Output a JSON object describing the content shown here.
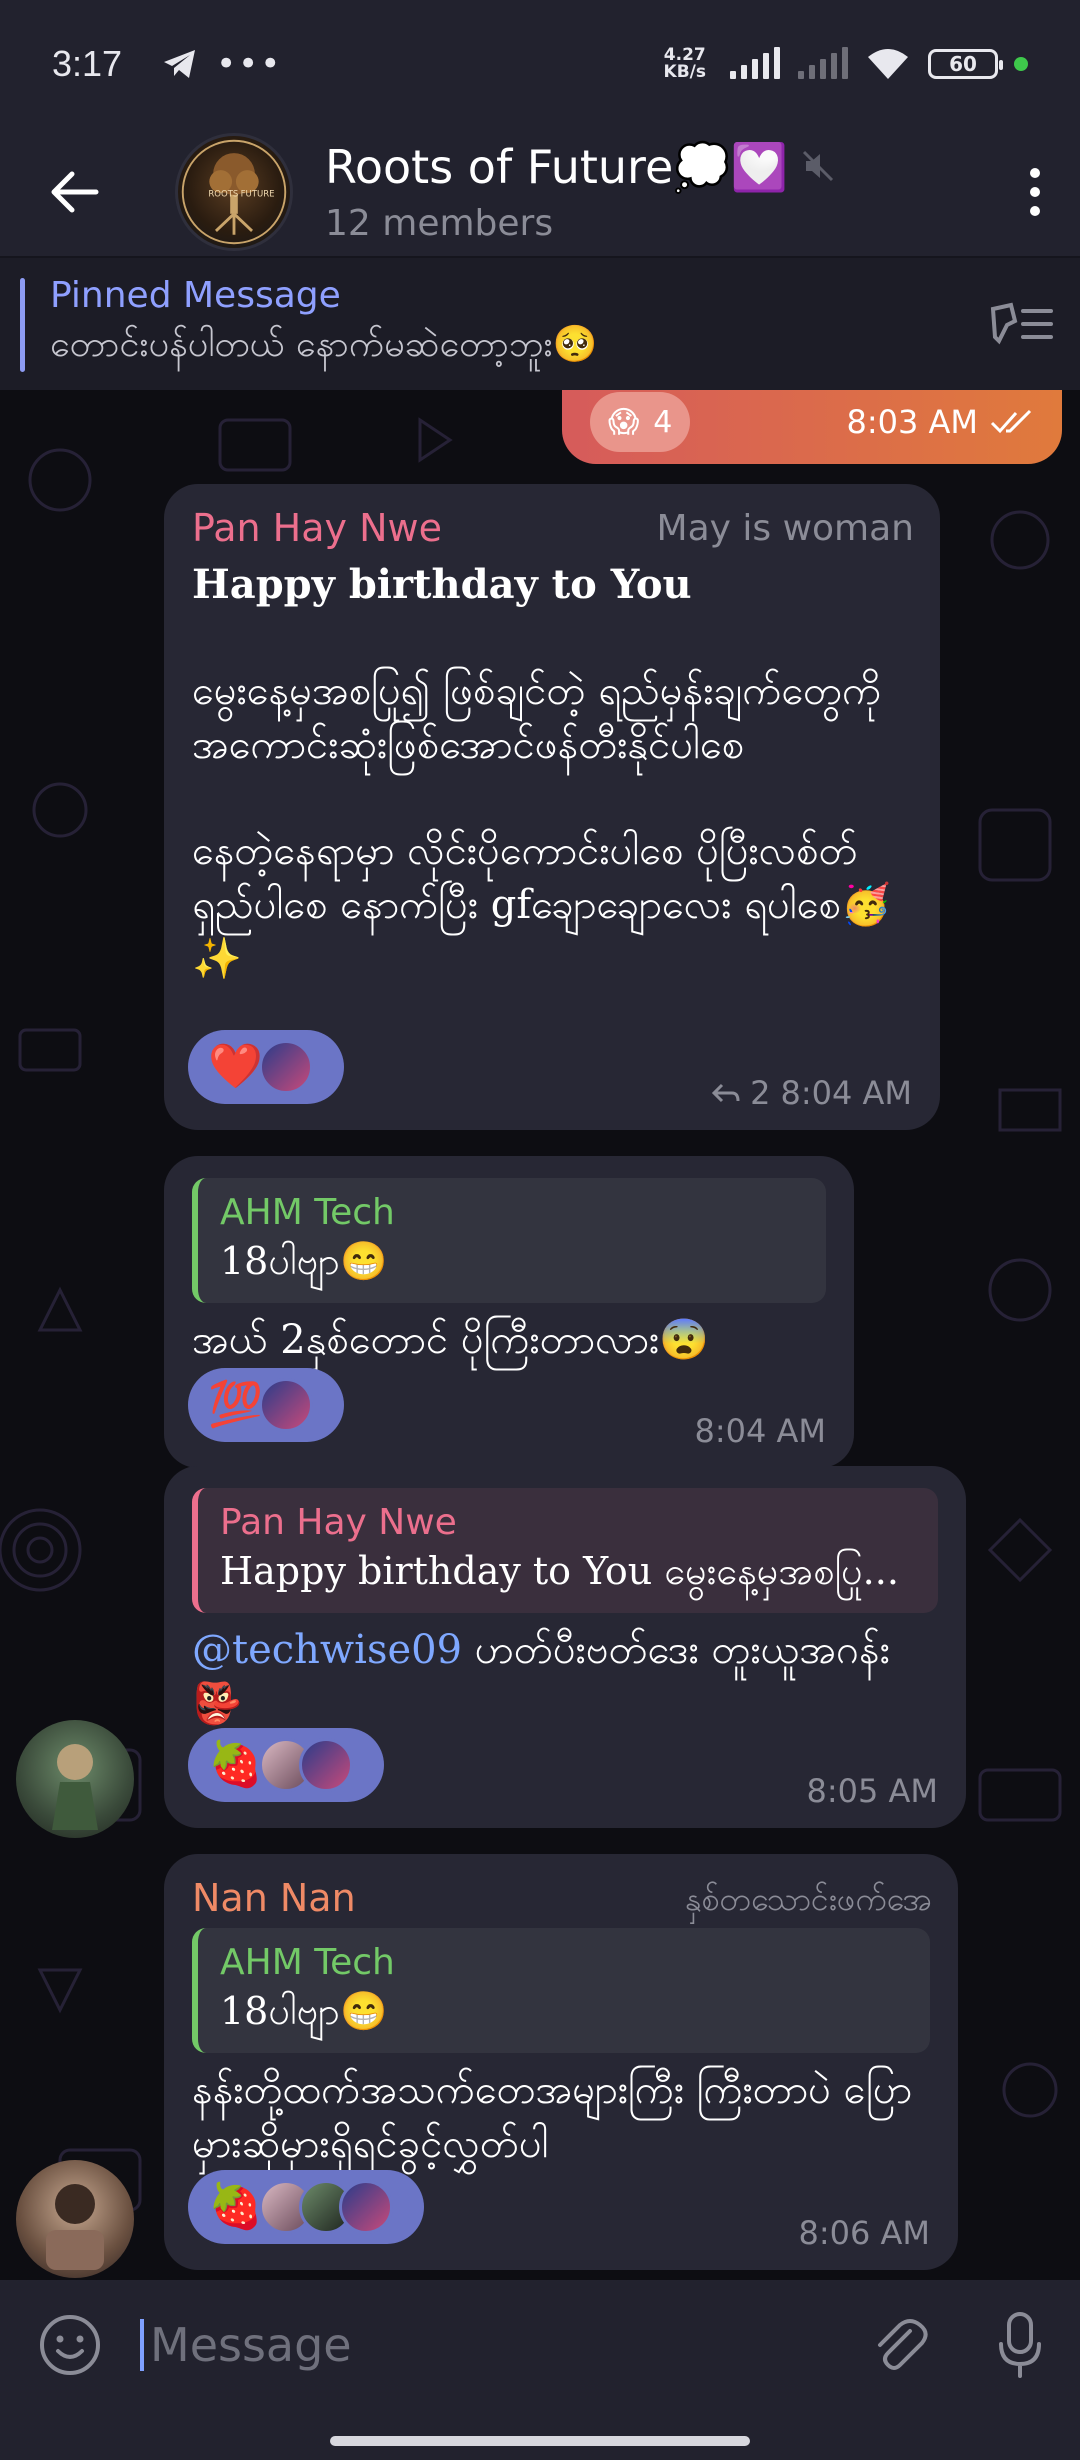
{
  "status_bar": {
    "time": "3:17",
    "net_speed_value": "4.27",
    "net_speed_unit": "KB/s",
    "battery": "60",
    "icons": [
      "telegram-icon",
      "more-dots-icon",
      "signal-icon",
      "signal-no-sim-icon",
      "wifi-icon",
      "battery-icon"
    ]
  },
  "header": {
    "title": "Roots of Future💭💟",
    "subtitle": "12 members",
    "avatar_text_left": "ROOTS",
    "avatar_text_right": "FUTURE"
  },
  "pinned": {
    "title": "Pinned Message",
    "text": "တောင်းပန်ပါတယ် နောက်မဆဲတော့ဘူး🥺"
  },
  "messages": [
    {
      "type": "outgoing",
      "reaction": "😱",
      "reaction_count": "4",
      "time": "8:03 AM"
    },
    {
      "sender": "Pan Hay Nwe",
      "tag": "May is woman",
      "title": "Happy birthday to You",
      "p1": "မွေးနေ့မှအစပြု၍ ဖြစ်ချင်တဲ့ ရည်မှန်းချက်တွေကို အကောင်းဆုံးဖြစ်အောင်ဖန်တီးနိုင်ပါစေ",
      "p2": "နေတဲ့နေရာမှာ လိုင်းပိုကောင်းပါစေ ပိုပြီးလစ်တ်ရှည်ပါစေ နောက်ပြီး gfချောချောလေး ရပါစေ🥳✨",
      "reaction": "❤️",
      "replies": "2",
      "time": "8:04 AM"
    },
    {
      "quote_name": "AHM Tech",
      "quote_text": "18ပါဗျာ😁",
      "text": "အယ် 2နှစ်တောင် ပိုကြီးတာလား😨",
      "reaction": "💯",
      "time": "8:04 AM"
    },
    {
      "quote_name": "Pan Hay Nwe",
      "quote_text": "Happy birthday to You  မွေးနေ့မှအစပြု...",
      "mention": "@techwise09",
      "text": " ဟတ်ပီးဗတ်ဒေး တူးယူအဂန်း👺",
      "reaction": "🍓",
      "time": "8:05 AM"
    },
    {
      "sender": "Nan Nan",
      "tag": "နှစ်တသောင်းဖက်အေ",
      "quote_name": "AHM Tech",
      "quote_text": "18ပါဗျာ😁",
      "text": "နန်းတို့ထက်အသက်တေအများကြီး ကြီးတာပဲ ပြောမှားဆိုမှားရှိရင်ခွင့်လွှတ်ပါ",
      "reaction": "🍓",
      "time": "8:06 AM"
    }
  ],
  "input": {
    "placeholder": "Message"
  },
  "colors": {
    "accent": "#8fa0ff",
    "pink_name": "#ec6f8d",
    "green_name": "#73c967",
    "salmon_name": "#ef8a66",
    "reaction_pill": "#6b75c6",
    "bubble": "#272734"
  }
}
